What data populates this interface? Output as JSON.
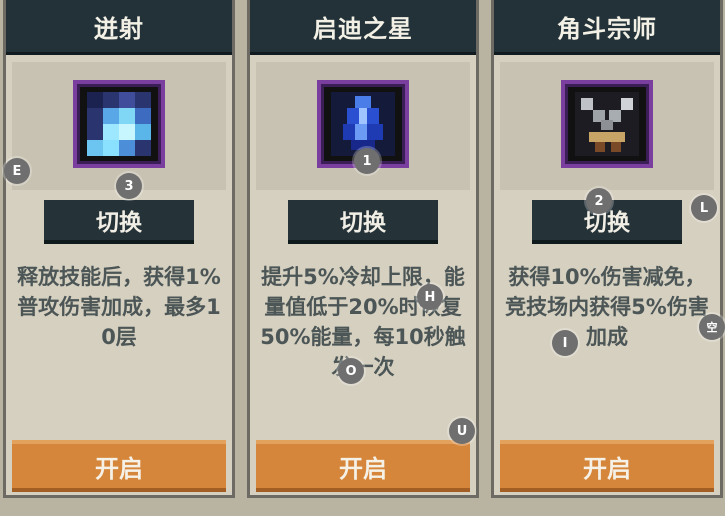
{
  "cards": [
    {
      "title": "迸射",
      "switch_label": "切换",
      "description": "释放技能后，获得1%普攻伤害加成，最多10层",
      "open_label": "开启",
      "icon": "blue-shard-icon"
    },
    {
      "title": "启迪之星",
      "switch_label": "切换",
      "description": "提升5%冷却上限，能量值低于20%时恢复50%能量，每10秒触发一次",
      "open_label": "开启",
      "icon": "blue-crystal-icon"
    },
    {
      "title": "角斗宗师",
      "switch_label": "切换",
      "description": "获得10%伤害减免，竞技场内获得5%伤害加成",
      "open_label": "开启",
      "icon": "crossed-swords-icon"
    }
  ],
  "badges": {
    "e": "E",
    "three": "3",
    "one": "1",
    "two": "2",
    "l": "L",
    "h": "H",
    "i": "I",
    "o": "O",
    "u": "U",
    "kong": "空"
  },
  "colors": {
    "title_bg": "#233238",
    "button_orange": "#d5863a",
    "frame_purple": "#7a3f9e"
  }
}
